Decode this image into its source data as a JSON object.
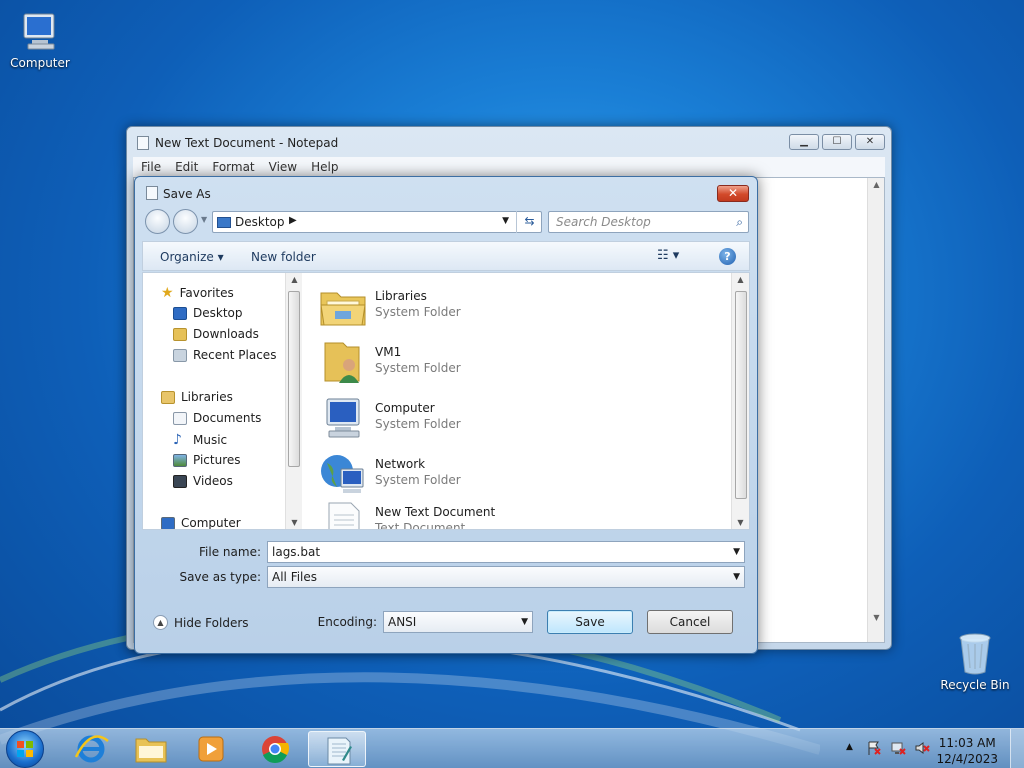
{
  "desktop": {
    "icons": [
      {
        "label": "Computer"
      },
      {
        "label": "Recycle Bin"
      }
    ]
  },
  "notepad": {
    "title": "New Text Document - Notepad",
    "menu": [
      "File",
      "Edit",
      "Format",
      "View",
      "Help"
    ]
  },
  "save_dialog": {
    "title": "Save As",
    "address": "Desktop",
    "search_placeholder": "Search Desktop",
    "toolbar": {
      "organize": "Organize",
      "new_folder": "New folder"
    },
    "nav": {
      "favorites": "Favorites",
      "favorites_items": [
        "Desktop",
        "Downloads",
        "Recent Places"
      ],
      "libraries": "Libraries",
      "libraries_items": [
        "Documents",
        "Music",
        "Pictures",
        "Videos"
      ],
      "computer": "Computer"
    },
    "files": [
      {
        "name": "Libraries",
        "type": "System Folder"
      },
      {
        "name": "VM1",
        "type": "System Folder"
      },
      {
        "name": "Computer",
        "type": "System Folder"
      },
      {
        "name": "Network",
        "type": "System Folder"
      },
      {
        "name": "New Text Document",
        "type": "Text Document"
      }
    ],
    "file_name_label": "File name:",
    "file_name_value": "lags.bat",
    "save_type_label": "Save as type:",
    "save_type_value": "All Files",
    "encoding_label": "Encoding:",
    "encoding_value": "ANSI",
    "hide_folders": "Hide Folders",
    "save": "Save",
    "cancel": "Cancel"
  },
  "taskbar": {
    "time": "11:03 AM",
    "date": "12/4/2023"
  }
}
